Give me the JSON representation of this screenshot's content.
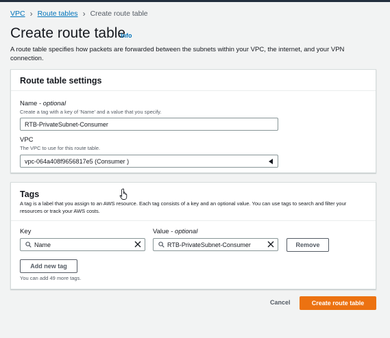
{
  "breadcrumb": {
    "items": [
      "VPC",
      "Route tables"
    ],
    "current": "Create route table"
  },
  "header": {
    "title": "Create route table",
    "info": "Info",
    "description": "A route table specifies how packets are forwarded between the subnets within your VPC, the internet, and your VPN connection."
  },
  "settings": {
    "title": "Route table settings",
    "name_label": "Name",
    "name_optional": "optional",
    "name_hint": "Create a tag with a key of 'Name' and a value that you specify.",
    "name_value": "RTB-PrivateSubnet-Consumer",
    "vpc_label": "VPC",
    "vpc_hint": "The VPC to use for this route table.",
    "vpc_value": "vpc-064a408f9656817e5 (Consumer )"
  },
  "tags": {
    "title": "Tags",
    "description": "A tag is a label that you assign to an AWS resource. Each tag consists of a key and an optional value. You can use tags to search and filter your resources or track your AWS costs.",
    "key_label": "Key",
    "value_label": "Value",
    "value_optional": "optional",
    "key_value": "Name",
    "value_value": "RTB-PrivateSubnet-Consumer",
    "remove_label": "Remove",
    "add_label": "Add new tag",
    "limit_text": "You can add 49 more tags."
  },
  "footer": {
    "cancel_label": "Cancel",
    "create_label": "Create route table"
  },
  "colors": {
    "primary": "#ec7211",
    "link": "#0073bb"
  }
}
